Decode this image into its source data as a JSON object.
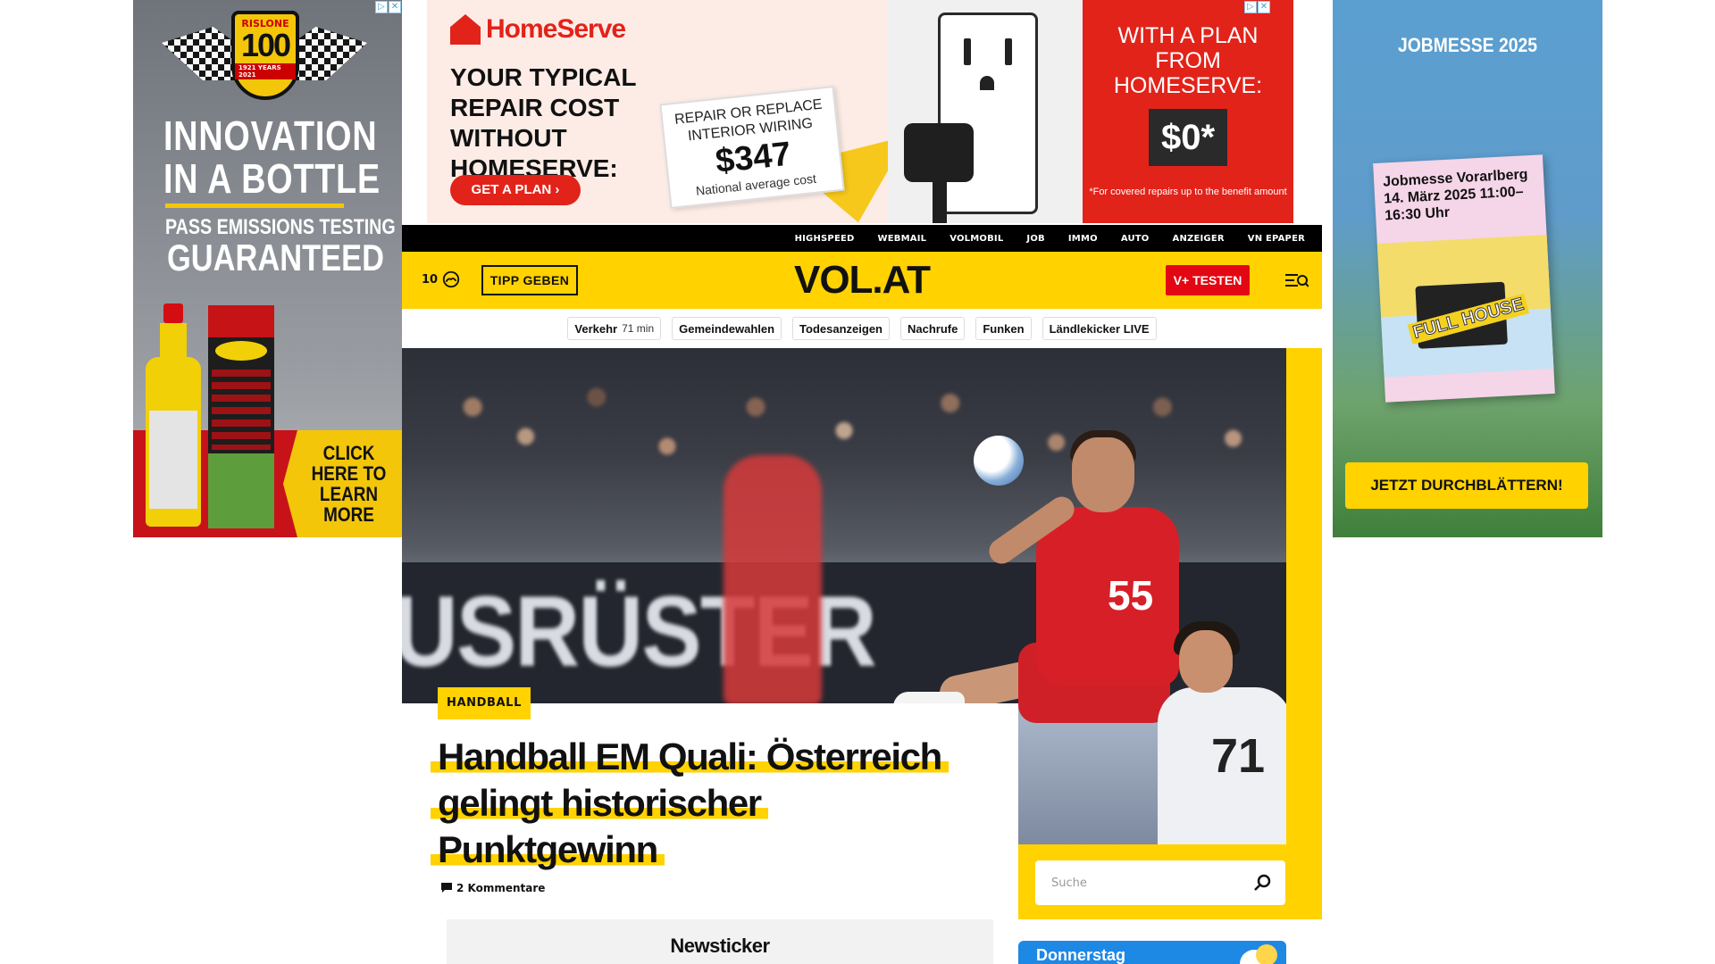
{
  "ads": {
    "left": {
      "brand_badge": "RISLONE",
      "badge_number": "100",
      "badge_years": "1921 YEARS 2021",
      "headline": "INNOVATION IN A BOTTLE",
      "sub1": "PASS EMISSIONS TESTING",
      "sub2": "GUARANTEED",
      "cta": "CLICK HERE TO LEARN MORE",
      "colors": {
        "accent": "#f3c60a",
        "red": "#c8121a"
      }
    },
    "top": {
      "logo": "HomeServe",
      "headline": "YOUR TYPICAL REPAIR COST WITHOUT HOMESERVE:",
      "button": "GET A PLAN ›",
      "card_line1": "REPAIR OR REPLACE INTERIOR WIRING",
      "card_price": "$347",
      "card_line3": "National average cost",
      "right_text": "WITH A PLAN FROM HOMESERVE:",
      "right_price": "$0*",
      "right_note": "*For covered repairs up to the benefit amount",
      "colors": {
        "brand": "#e2231a"
      }
    },
    "right": {
      "title": "JOBMESSE 2025",
      "mag_title": "Jobmesse Vorarlberg 14. März 2025 11:00–16:30 Uhr",
      "mag_tag": "FULL HOUSE",
      "button": "JETZT DURCHBLÄTTERN!"
    },
    "adchoices": {
      "i": "▷",
      "x": "✕"
    }
  },
  "nav": {
    "top_links": [
      "HIGHSPEED",
      "WEBMAIL",
      "VOLMOBIL",
      "JOB",
      "IMMO",
      "AUTO",
      "ANZEIGER",
      "VN EPAPER"
    ],
    "weather_temp": "10",
    "weather_icon": "cloud-sun-icon",
    "tipp_button": "TIPP GEBEN",
    "logo": "VOL.AT",
    "vplus_button": "V+ TESTEN",
    "menu_icon": "menu-search-icon",
    "quicklinks": [
      {
        "label": "Verkehr",
        "meta": "71 min"
      },
      {
        "label": "Gemeindewahlen",
        "meta": ""
      },
      {
        "label": "Todesanzeigen",
        "meta": ""
      },
      {
        "label": "Nachrufe",
        "meta": ""
      },
      {
        "label": "Funken",
        "meta": ""
      },
      {
        "label": "Ländlekicker LIVE",
        "meta": ""
      }
    ],
    "colors": {
      "brand_yellow": "#ffd200",
      "vplus_red": "#e30613"
    }
  },
  "hero": {
    "image_banner_text": "USRÜSTER",
    "player_number": "55",
    "opponent_number": "71",
    "category": "HANDBALL",
    "headline": "Handball EM Quali: Österreich gelingt historischer Punktgewinn",
    "comments": "2 Kommentare"
  },
  "search": {
    "placeholder": "Suche"
  },
  "newsticker": {
    "title": "Newsticker"
  },
  "weather_card": {
    "day": "Donnerstag"
  }
}
